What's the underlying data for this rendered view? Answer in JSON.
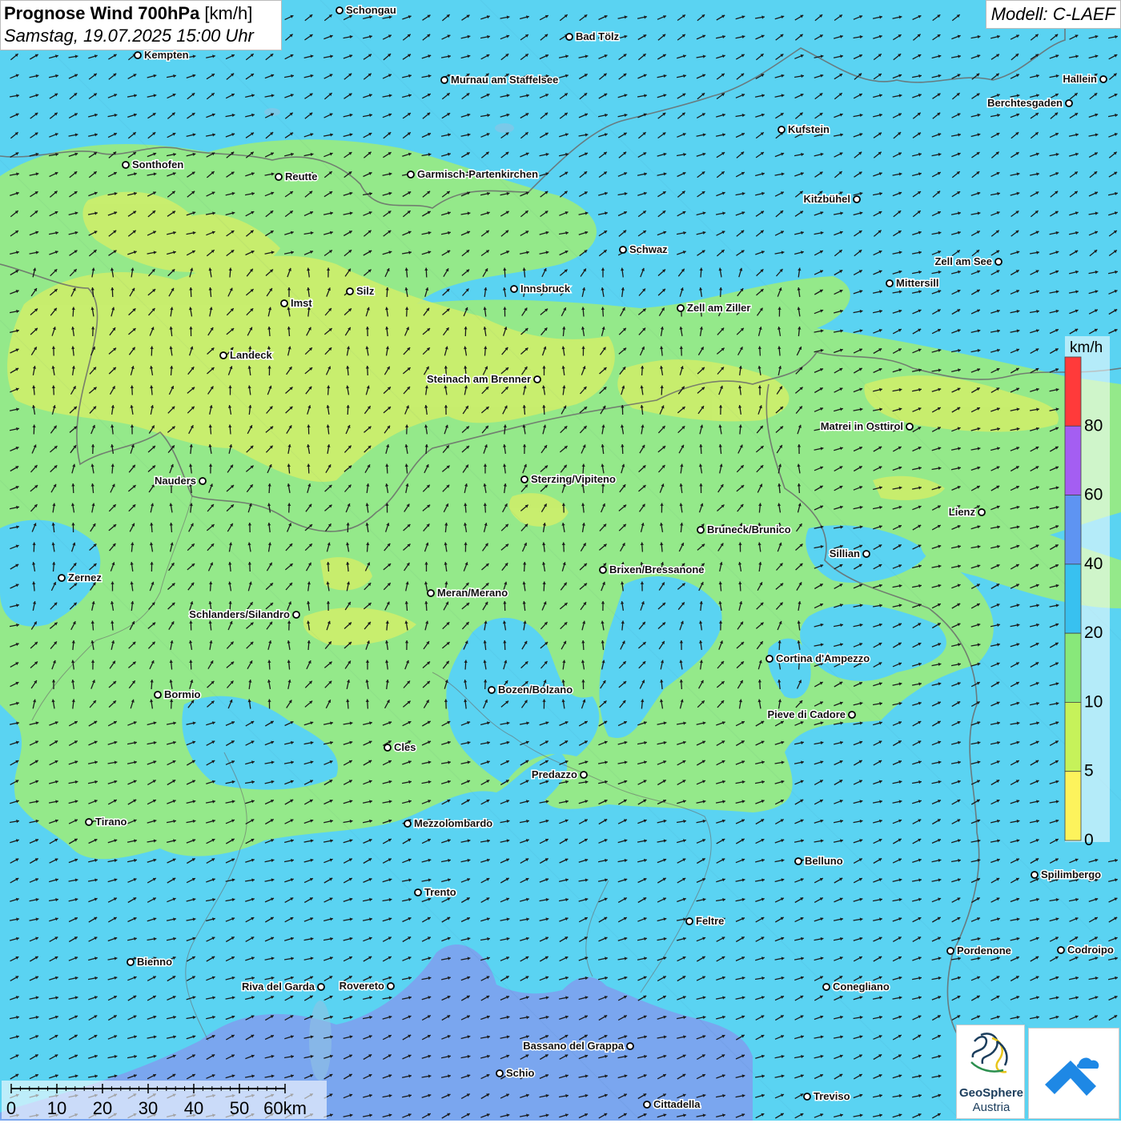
{
  "header": {
    "title_bold": "Prognose Wind 700hPa",
    "title_unit": " [km/h]",
    "subtitle": "Samstag, 19.07.2025 15:00 Uhr"
  },
  "model_label": "Modell: C-LAEF",
  "legend": {
    "unit": "km/h",
    "classes": [
      {
        "color": "#ff3a3a",
        "label": ""
      },
      {
        "color": "#a45ef2",
        "label": "80"
      },
      {
        "color": "#5e94f2",
        "label": "60"
      },
      {
        "color": "#38c1f0",
        "label": "40"
      },
      {
        "color": "#88e87a",
        "label": "20"
      },
      {
        "color": "#c6f25a",
        "label": "10"
      },
      {
        "color": "#fdf35c",
        "label": "5"
      },
      {
        "color": "",
        "label": "0"
      }
    ]
  },
  "scale_bar": {
    "ticks": [
      "0",
      "10",
      "20",
      "30",
      "40",
      "50",
      "60km"
    ]
  },
  "logos": {
    "geosphere_line1": "GeoSphere",
    "geosphere_line2": "Austria"
  },
  "wind_direction": "southwest",
  "cities": [
    {
      "name": "Schongau",
      "label_side": "right"
    },
    {
      "name": "Bad Tölz",
      "label_side": "right"
    },
    {
      "name": "Kempten",
      "label_side": "right"
    },
    {
      "name": "Murnau am Staffelsee",
      "label_side": "right"
    },
    {
      "name": "Hallein",
      "label_side": "left"
    },
    {
      "name": "Berchtesgaden",
      "label_side": "left"
    },
    {
      "name": "Kufstein",
      "label_side": "right"
    },
    {
      "name": "Sonthofen",
      "label_side": "right"
    },
    {
      "name": "Reutte",
      "label_side": "right"
    },
    {
      "name": "Garmisch-Partenkirchen",
      "label_side": "right"
    },
    {
      "name": "Kitzbühel",
      "label_side": "left"
    },
    {
      "name": "Schwaz",
      "label_side": "right"
    },
    {
      "name": "Zell am See",
      "label_side": "left"
    },
    {
      "name": "Silz",
      "label_side": "right"
    },
    {
      "name": "Innsbruck",
      "label_side": "right"
    },
    {
      "name": "Mittersill",
      "label_side": "right"
    },
    {
      "name": "Imst",
      "label_side": "right"
    },
    {
      "name": "Zell am Ziller",
      "label_side": "right"
    },
    {
      "name": "Landeck",
      "label_side": "right"
    },
    {
      "name": "Steinach am Brenner",
      "label_side": "left"
    },
    {
      "name": "Matrei in Osttirol",
      "label_side": "left"
    },
    {
      "name": "Nauders",
      "label_side": "left"
    },
    {
      "name": "Sterzing/Vipiteno",
      "label_side": "right"
    },
    {
      "name": "Lienz",
      "label_side": "left"
    },
    {
      "name": "Bruneck/Brunico",
      "label_side": "right"
    },
    {
      "name": "Sillian",
      "label_side": "left"
    },
    {
      "name": "Brixen/Bressanone",
      "label_side": "right"
    },
    {
      "name": "Zernez",
      "label_side": "right"
    },
    {
      "name": "Meran/Merano",
      "label_side": "right"
    },
    {
      "name": "Schlanders/Silandro",
      "label_side": "left"
    },
    {
      "name": "Cortina d'Ampezzo",
      "label_side": "right"
    },
    {
      "name": "Bozen/Bolzano",
      "label_side": "right"
    },
    {
      "name": "Bormio",
      "label_side": "right"
    },
    {
      "name": "Pieve di Cadore",
      "label_side": "left"
    },
    {
      "name": "Cles",
      "label_side": "right"
    },
    {
      "name": "Predazzo",
      "label_side": "left"
    },
    {
      "name": "Tirano",
      "label_side": "right"
    },
    {
      "name": "Mezzolombardo",
      "label_side": "right"
    },
    {
      "name": "Belluno",
      "label_side": "right"
    },
    {
      "name": "Spilimbergo",
      "label_side": "right"
    },
    {
      "name": "Trento",
      "label_side": "right"
    },
    {
      "name": "Feltre",
      "label_side": "right"
    },
    {
      "name": "Pordenone",
      "label_side": "right"
    },
    {
      "name": "Codroipo",
      "label_side": "right"
    },
    {
      "name": "Bienno",
      "label_side": "right"
    },
    {
      "name": "Riva del Garda",
      "label_side": "left"
    },
    {
      "name": "Rovereto",
      "label_side": "left"
    },
    {
      "name": "Conegliano",
      "label_side": "right"
    },
    {
      "name": "Bassano del Grappa",
      "label_side": "left"
    },
    {
      "name": "Schio",
      "label_side": "right"
    },
    {
      "name": "Treviso",
      "label_side": "right"
    },
    {
      "name": "Cittadella",
      "label_side": "right"
    }
  ]
}
